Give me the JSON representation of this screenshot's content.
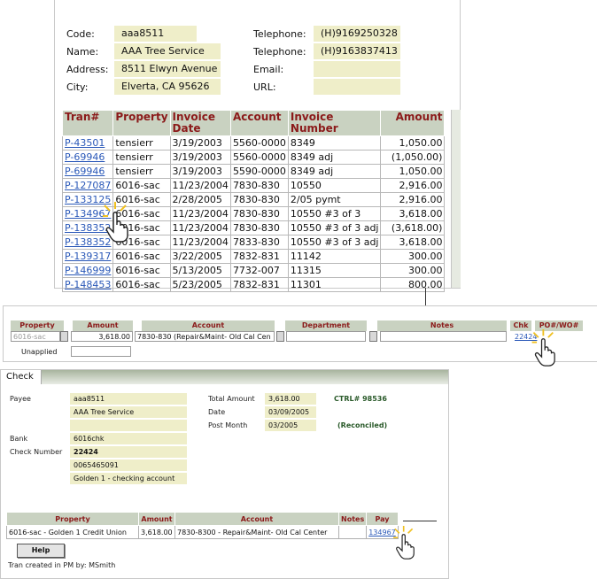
{
  "vendor": {
    "code_label": "Code:",
    "code": "aaa8511",
    "name_label": "Name:",
    "name": "AAA Tree Service",
    "address_label": "Address:",
    "address": "8511 Elwyn Avenue",
    "city_label": "City:",
    "city": "Elverta, CA 95626",
    "telephone_label": "Telephone:",
    "telephone1": "(H)9169250328",
    "telephone2": "(H)9163837413",
    "email_label": "Email:",
    "email": "",
    "url_label": "URL:",
    "url": ""
  },
  "transactions": {
    "headers": [
      "Tran#",
      "Property",
      "Invoice Date",
      "Account",
      "Invoice Number",
      "Amount"
    ],
    "rows": [
      {
        "tran": "P-43501",
        "property": "tensierr",
        "date": "3/19/2003",
        "account": "5560-0000",
        "invoice": "8349",
        "amount": "1,050.00"
      },
      {
        "tran": "P-69946",
        "property": "tensierr",
        "date": "3/19/2003",
        "account": "5560-0000",
        "invoice": "8349 adj",
        "amount": "(1,050.00)"
      },
      {
        "tran": "P-69946",
        "property": "tensierr",
        "date": "3/19/2003",
        "account": "5590-0000",
        "invoice": "8349 adj",
        "amount": "1,050.00"
      },
      {
        "tran": "P-127087",
        "property": "6016-sac",
        "date": "11/23/2004",
        "account": "7830-830",
        "invoice": "10550",
        "amount": "2,916.00"
      },
      {
        "tran": "P-133125",
        "property": "6016-sac",
        "date": "2/28/2005",
        "account": "7830-830",
        "invoice": "2/05 pymt",
        "amount": "2,916.00"
      },
      {
        "tran": "P-134967",
        "property": "6016-sac",
        "date": "11/23/2004",
        "account": "7830-830",
        "invoice": "10550 #3 of 3",
        "amount": "3,618.00"
      },
      {
        "tran": "P-138352",
        "property": "6016-sac",
        "date": "11/23/2004",
        "account": "7830-830",
        "invoice": "10550 #3 of 3 adj",
        "amount": "(3,618.00)"
      },
      {
        "tran": "P-138352",
        "property": "6016-sac",
        "date": "11/23/2004",
        "account": "7833-830",
        "invoice": "10550 #3 of 3 adj",
        "amount": "3,618.00"
      },
      {
        "tran": "P-139317",
        "property": "6016-sac",
        "date": "3/22/2005",
        "account": "7832-831",
        "invoice": "11142",
        "amount": "300.00"
      },
      {
        "tran": "P-146999",
        "property": "6016-sac",
        "date": "5/13/2005",
        "account": "7732-007",
        "invoice": "11315",
        "amount": "300.00"
      },
      {
        "tran": "P-148453",
        "property": "6016-sac",
        "date": "5/23/2005",
        "account": "7832-831",
        "invoice": "11301",
        "amount": "800.00"
      }
    ]
  },
  "detail_line": {
    "headers": [
      "Property",
      "Amount",
      "Account",
      "Department",
      "Notes",
      "Chk",
      "PO#/WO#"
    ],
    "property": "6016-sac",
    "amount": "3,618.00",
    "account": "7830-830 (Repair&Maint- Old Cal Cen",
    "check_link": "22424",
    "unapplied_label": "Unapplied"
  },
  "check": {
    "tab_label": "Check",
    "payee_label": "Payee",
    "payee_code": "aaa8511",
    "payee_name": "AAA Tree Service",
    "bank_label": "Bank",
    "bank": "6016chk",
    "check_number_label": "Check Number",
    "check_number": "22424",
    "account_number": "0065465091",
    "bank_name": "Golden 1 - checking account",
    "total_amount_label": "Total Amount",
    "total_amount": "3,618.00",
    "ctrl": "CTRL# 98536",
    "date_label": "Date",
    "date": "03/09/2005",
    "post_month_label": "Post Month",
    "post_month": "03/2005",
    "status": "(Reconciled)",
    "pay_headers": [
      "Property",
      "Amount",
      "Account",
      "Notes",
      "Pay"
    ],
    "pay_row": {
      "property": "6016-sac - Golden 1 Credit Union",
      "amount": "3,618.00",
      "account": "7830-8300 - Repair&Maint- Old Cal Center",
      "notes": "",
      "pay": "134967"
    },
    "help_button": "Help",
    "created_by": "Tran created in PM by: MSmith"
  },
  "colors": {
    "header_bg": "#c9d2c1",
    "header_text": "#8b1a1a",
    "field_bg": "#efeec9",
    "link": "#2a58b8"
  }
}
